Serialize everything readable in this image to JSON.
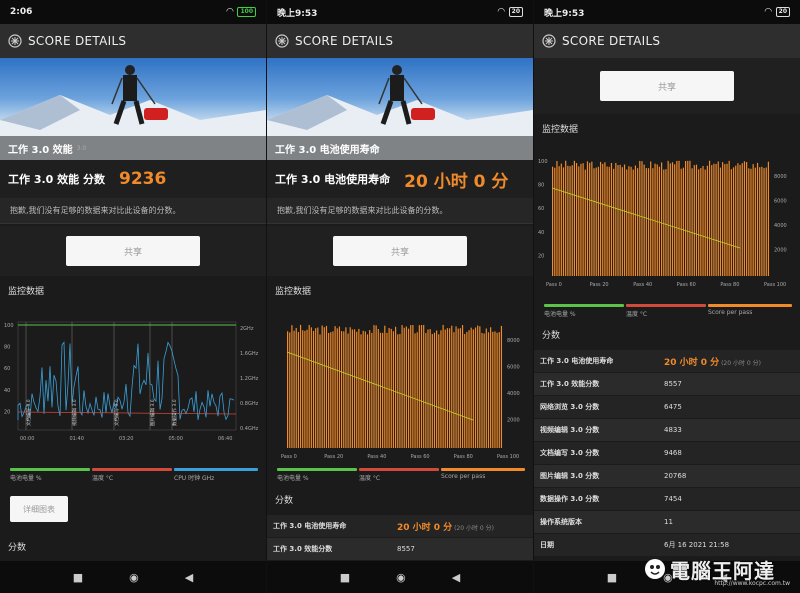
{
  "panel1": {
    "status": {
      "time": "2:06",
      "battery": "100"
    },
    "app_title": "SCORE DETAILS",
    "hero_caption": "工作 3.0 效能",
    "hero_caption_suffix": "3.0",
    "score_label": "工作 3.0 效能 分数",
    "score_value": "9236",
    "sorry": "抱歉,我们没有足够的数据来对比此设备的分数。",
    "share": "共享",
    "monitor": "监控数据",
    "chart_right_ticks": [
      "2GHz",
      "1.6GHz",
      "1.2GHz",
      "0.8GHz",
      "0.4GHz"
    ],
    "chart_left_ticks": [
      "100",
      "80",
      "60",
      "40",
      "20"
    ],
    "chart_x_ticks": [
      "00:00",
      "01:40",
      "03:20",
      "05:00",
      "06:40"
    ],
    "chart_vlabels": [
      "文档编写 3.0",
      "视频编辑 3.0",
      "文档编写 3.0",
      "图片编辑 3.0",
      "数据操作 3.0"
    ],
    "legend": [
      "电池电量 %",
      "温度 °C",
      "CPU 时钟 GHz"
    ],
    "detail": "详细图表",
    "scores": "分数"
  },
  "panel2": {
    "status": {
      "time": "晚上9:53",
      "battery": "20"
    },
    "app_title": "SCORE DETAILS",
    "hero_caption": "工作 3.0 电池使用寿命",
    "score_label": "工作 3.0 电池使用寿命",
    "score_value": "20 小时 0 分",
    "sorry": "抱歉,我们没有足够的数据来对比此设备的分数。",
    "share": "共享",
    "monitor": "监控数据",
    "chart_right_ticks": [
      "8000",
      "6000",
      "4000",
      "2000"
    ],
    "chart_x_ticks": [
      "Pass 0",
      "Pass 20",
      "Pass 40",
      "Pass 60",
      "Pass 80",
      "Pass 100"
    ],
    "legend": [
      "电池电量 %",
      "温度 °C",
      "Score per pass"
    ],
    "scores": "分数",
    "rows": [
      {
        "k": "工作 3.0 电池使用寿命",
        "v": "20 小时 0 分",
        "sub": "(20 小时 0 分)"
      },
      {
        "k": "工作 3.0 效能分数",
        "v": "8557"
      }
    ]
  },
  "panel3": {
    "status": {
      "time": "晚上9:53",
      "battery": "20"
    },
    "app_title": "SCORE DETAILS",
    "share": "共享",
    "monitor": "监控数据",
    "chart_left_ticks": [
      "100",
      "80",
      "60",
      "40",
      "20"
    ],
    "chart_right_ticks": [
      "8000",
      "6000",
      "4000",
      "2000"
    ],
    "chart_x_ticks": [
      "Pass 0",
      "Pass 20",
      "Pass 40",
      "Pass 60",
      "Pass 80",
      "Pass 100"
    ],
    "legend": [
      "电池电量 %",
      "温度 °C",
      "Score per pass"
    ],
    "scores": "分数",
    "rows": [
      {
        "k": "工作 3.0 电池使用寿命",
        "v": "20 小时 0 分",
        "sub": "(20 小时 0 分)"
      },
      {
        "k": "工作 3.0 效能分数",
        "v": "8557"
      },
      {
        "k": "网络浏览 3.0 分数",
        "v": "6475"
      },
      {
        "k": "视频编辑 3.0 分数",
        "v": "4833"
      },
      {
        "k": "文档编写 3.0 分数",
        "v": "9468"
      },
      {
        "k": "图片编辑 3.0 分数",
        "v": "20768"
      },
      {
        "k": "数据操作 3.0 分数",
        "v": "7454"
      },
      {
        "k": "操作系统版本",
        "v": "11"
      },
      {
        "k": "日期",
        "v": "6月 16 2021 21:58"
      }
    ]
  },
  "colors": {
    "accent": "#f08a2a",
    "green": "#5bc24a",
    "red": "#d24a3a",
    "blue": "#3aa0d8",
    "yellow": "#c8d820"
  },
  "chart_data": [
    {
      "type": "line",
      "series": [
        {
          "name": "电池电量 %"
        },
        {
          "name": "温度 °C"
        },
        {
          "name": "CPU 时钟 GHz"
        }
      ],
      "x": [
        "00:00",
        "01:40",
        "03:20",
        "05:00",
        "06:40"
      ]
    },
    {
      "type": "bar",
      "series": [
        {
          "name": "Score per pass"
        },
        {
          "name": "电池电量 %"
        }
      ],
      "x": [
        "Pass 0",
        "Pass 20",
        "Pass 40",
        "Pass 60",
        "Pass 80",
        "Pass 100"
      ],
      "ylim": [
        0,
        100
      ],
      "y2ticks": [
        2000,
        4000,
        6000,
        8000
      ]
    }
  ],
  "watermark": {
    "text": "電腦王阿達",
    "url": "http://www.kocpc.com.tw"
  },
  "nav": {
    "back": "◀",
    "home": "◉",
    "recent": "■"
  }
}
